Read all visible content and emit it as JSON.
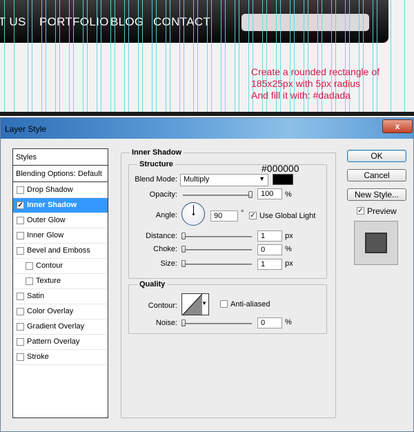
{
  "canvas": {
    "nav_items": [
      "T US",
      "PORTFOLIO",
      "BLOG",
      "CONTACT"
    ],
    "note_lines": [
      "Create a rounded rectangle of",
      "185x25px with 5px radius",
      "And fill it with: #dadada"
    ],
    "search_fill": "#dadada",
    "note_color": "#d61a4a",
    "guide_color": "#5fd7e6"
  },
  "dialog": {
    "title": "Layer Style",
    "close_glyph": "x",
    "styles_header": "Styles",
    "blending_default": "Blending Options: Default",
    "styles": [
      {
        "label": "Drop Shadow",
        "checked": false,
        "selected": false
      },
      {
        "label": "Inner Shadow",
        "checked": true,
        "selected": true
      },
      {
        "label": "Outer Glow",
        "checked": false,
        "selected": false
      },
      {
        "label": "Inner Glow",
        "checked": false,
        "selected": false
      },
      {
        "label": "Bevel and Emboss",
        "checked": false,
        "selected": false
      },
      {
        "label": "Contour",
        "checked": false,
        "selected": false
      },
      {
        "label": "Texture",
        "checked": false,
        "selected": false
      },
      {
        "label": "Satin",
        "checked": false,
        "selected": false
      },
      {
        "label": "Color Overlay",
        "checked": false,
        "selected": false
      },
      {
        "label": "Gradient Overlay",
        "checked": false,
        "selected": false
      },
      {
        "label": "Pattern Overlay",
        "checked": false,
        "selected": false
      },
      {
        "label": "Stroke",
        "checked": false,
        "selected": false
      }
    ],
    "panel_title": "Inner Shadow",
    "structure": {
      "title": "Structure",
      "color_note": "#000000",
      "blend_mode_label": "Blend Mode:",
      "blend_mode_value": "Multiply",
      "shadow_color": "#000000",
      "opacity_label": "Opacity:",
      "opacity_value": "100",
      "opacity_level": 1.0,
      "percent": "%",
      "angle_label": "Angle:",
      "angle_value": "90",
      "degree": "°",
      "use_global_light_label": "Use Global Light",
      "use_global_light": true,
      "distance_label": "Distance:",
      "distance_value": "1",
      "distance_level": 0.0,
      "choke_label": "Choke:",
      "choke_value": "0",
      "choke_level": 0.0,
      "size_label": "Size:",
      "size_value": "1",
      "size_level": 0.0,
      "px": "px"
    },
    "quality": {
      "title": "Quality",
      "contour_label": "Contour:",
      "anti_aliased_label": "Anti-aliased",
      "anti_aliased": false,
      "noise_label": "Noise:",
      "noise_value": "0",
      "noise_level": 0.0,
      "percent": "%"
    },
    "buttons": {
      "ok": "OK",
      "cancel": "Cancel",
      "new_style": "New Style..."
    },
    "preview_label": "Preview",
    "preview_checked": true
  }
}
